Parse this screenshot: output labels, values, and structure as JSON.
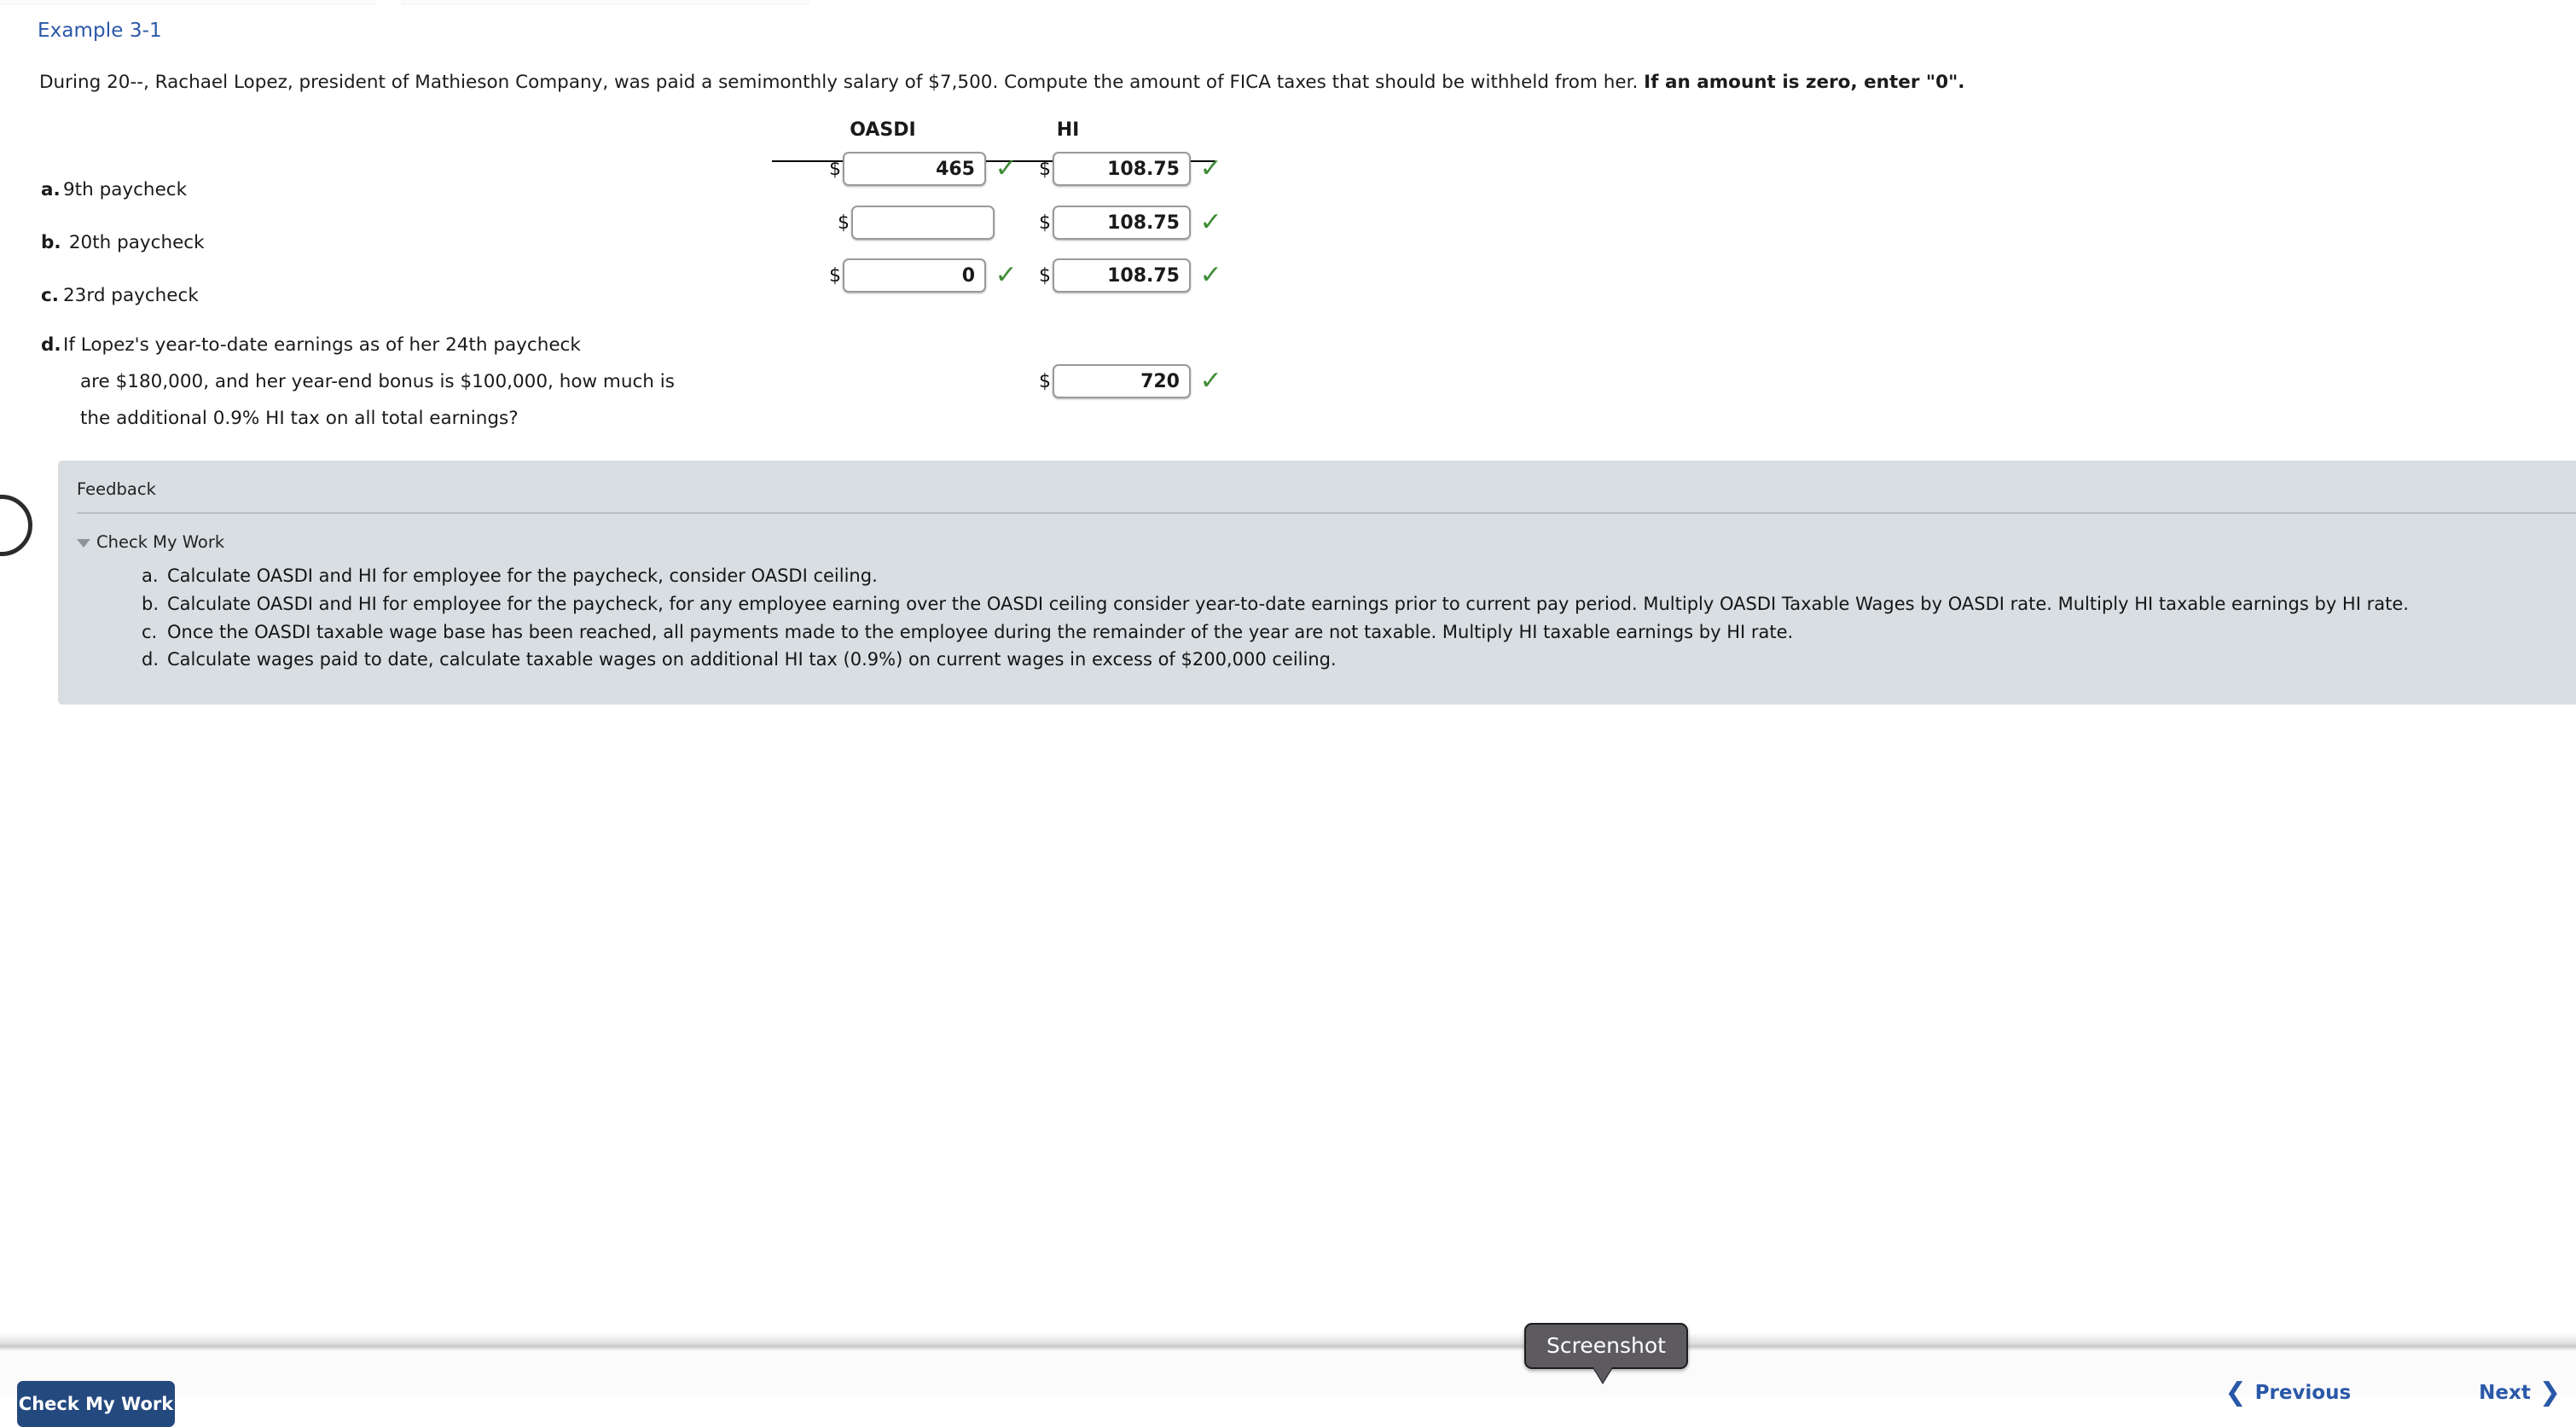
{
  "example": {
    "link_label": "Example 3-1"
  },
  "prompt": {
    "text": "During 20--, Rachael Lopez, president of Mathieson Company, was paid a semimonthly salary of $7,500. Compute the amount of FICA taxes that should be withheld from her. ",
    "bold_text": "If an amount is zero, enter \"0\"."
  },
  "table": {
    "headers": {
      "oasdi": "OASDI",
      "hi": "HI"
    },
    "currency_symbol": "$",
    "check_glyph": "✓",
    "rows": [
      {
        "letter": "a.",
        "label": "9th paycheck",
        "oasdi_value": "465",
        "oasdi_correct": true,
        "hi_value": "108.75",
        "hi_correct": true
      },
      {
        "letter": "b.",
        "label": " 20th paycheck",
        "oasdi_value": "",
        "oasdi_correct": false,
        "hi_value": "108.75",
        "hi_correct": true
      },
      {
        "letter": "c.",
        "label": "23rd paycheck",
        "oasdi_value": "0",
        "oasdi_correct": true,
        "hi_value": "108.75",
        "hi_correct": true
      }
    ],
    "row_d": {
      "letter": "d.",
      "line1": "If Lopez's year-to-date earnings as of her 24th paycheck",
      "line2": "are $180,000, and her year-end bonus is $100,000, how much is",
      "line3": "the additional 0.9% HI tax on all total earnings?",
      "hi_value": "720",
      "hi_correct": true
    }
  },
  "feedback": {
    "title": "Feedback",
    "check_my_work_label": "Check My Work",
    "items": [
      {
        "marker": "a.",
        "text": "Calculate OASDI and HI for employee for the paycheck, consider OASDI ceiling."
      },
      {
        "marker": "b.",
        "text": "Calculate OASDI and HI for employee for the paycheck, for any employee earning over the OASDI ceiling consider year-to-date earnings prior to current pay period. Multiply OASDI Taxable Wages by OASDI rate. Multiply HI taxable earnings by HI rate."
      },
      {
        "marker": "c.",
        "text": "Once the OASDI taxable wage base has been reached, all payments made to the employee during the remainder of the year are not taxable. Multiply HI taxable earnings by HI rate."
      },
      {
        "marker": "d.",
        "text": "Calculate wages paid to date, calculate taxable wages on additional HI tax (0.9%) on current wages in excess of $200,000 ceiling."
      }
    ]
  },
  "tooltip": {
    "label": "Screenshot"
  },
  "footer": {
    "check_my_work_button": "Check My Work",
    "previous_label": "Previous",
    "next_label": "Next",
    "previous_chevron": "❮",
    "next_chevron": "❯"
  },
  "colors": {
    "link_blue": "#2a58a8",
    "check_green": "#3f8c36",
    "feedback_bg": "#d8dee2",
    "button_blue": "#24497f",
    "tooltip_bg": "#5d5b60"
  }
}
